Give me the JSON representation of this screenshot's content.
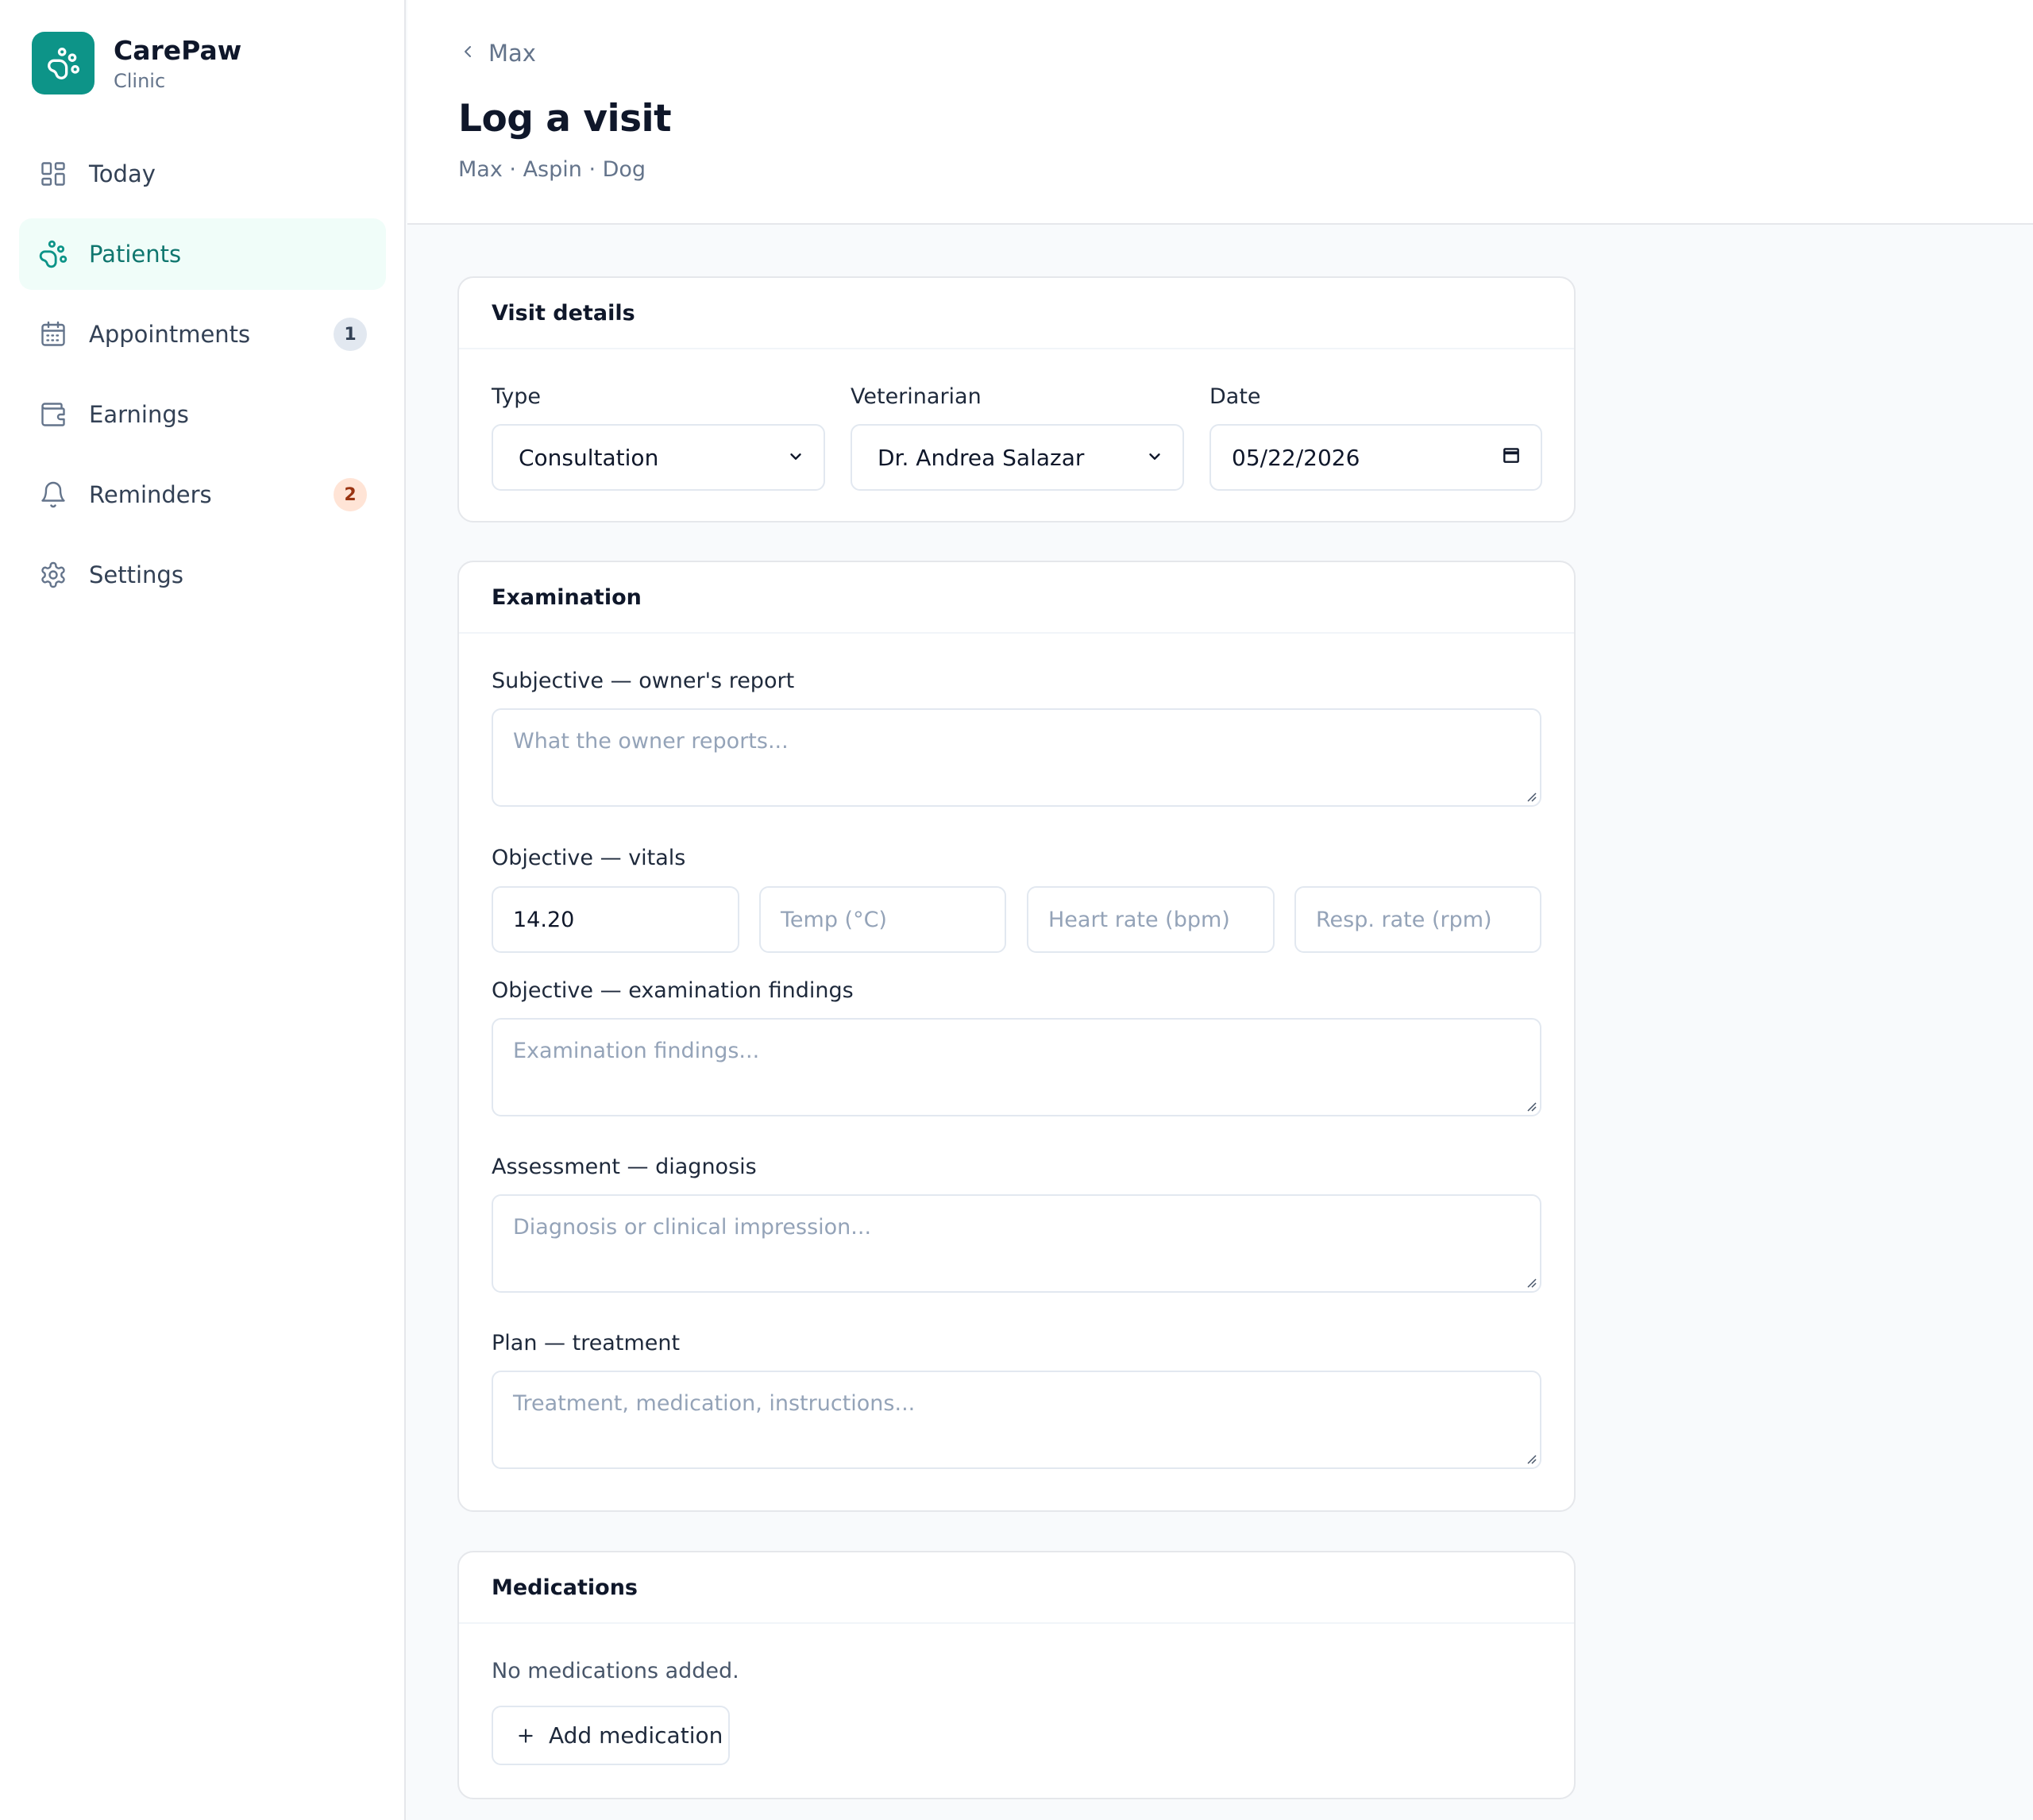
{
  "brand": {
    "name": "CarePaw",
    "subtitle": "Clinic"
  },
  "colors": {
    "accent": "#0d9488",
    "active_bg": "#f0fdf9",
    "active_text": "#0f766e"
  },
  "nav": {
    "items": [
      {
        "label": "Today",
        "icon": "grid-icon",
        "active": false
      },
      {
        "label": "Patients",
        "icon": "paw-icon",
        "active": true
      },
      {
        "label": "Appointments",
        "icon": "calendar-icon",
        "active": false,
        "badge": "1"
      },
      {
        "label": "Earnings",
        "icon": "wallet-icon",
        "active": false
      },
      {
        "label": "Reminders",
        "icon": "bell-icon",
        "active": false,
        "badge": "2"
      },
      {
        "label": "Settings",
        "icon": "gear-icon",
        "active": false
      }
    ]
  },
  "header": {
    "back_label": "Max",
    "title": "Log a visit",
    "subtitle": "Max · Aspin · Dog"
  },
  "visit_details": {
    "title": "Visit details",
    "type_label": "Type",
    "type_value": "Consultation",
    "vet_label": "Veterinarian",
    "vet_value": "Dr. Andrea Salazar",
    "date_label": "Date",
    "date_value": "05/22/2026"
  },
  "examination": {
    "title": "Examination",
    "subjective_label": "Subjective — owner's report",
    "subjective_placeholder": "What the owner reports...",
    "vitals_label": "Objective — vitals",
    "weight_value": "14.20",
    "temp_placeholder": "Temp (°C)",
    "heart_placeholder": "Heart rate (bpm)",
    "resp_placeholder": "Resp. rate (rpm)",
    "findings_label": "Objective — examination findings",
    "findings_placeholder": "Examination findings...",
    "assessment_label": "Assessment — diagnosis",
    "assessment_placeholder": "Diagnosis or clinical impression...",
    "plan_label": "Plan — treatment",
    "plan_placeholder": "Treatment, medication, instructions..."
  },
  "medications": {
    "title": "Medications",
    "empty_text": "No medications added.",
    "add_label": "Add medication"
  }
}
